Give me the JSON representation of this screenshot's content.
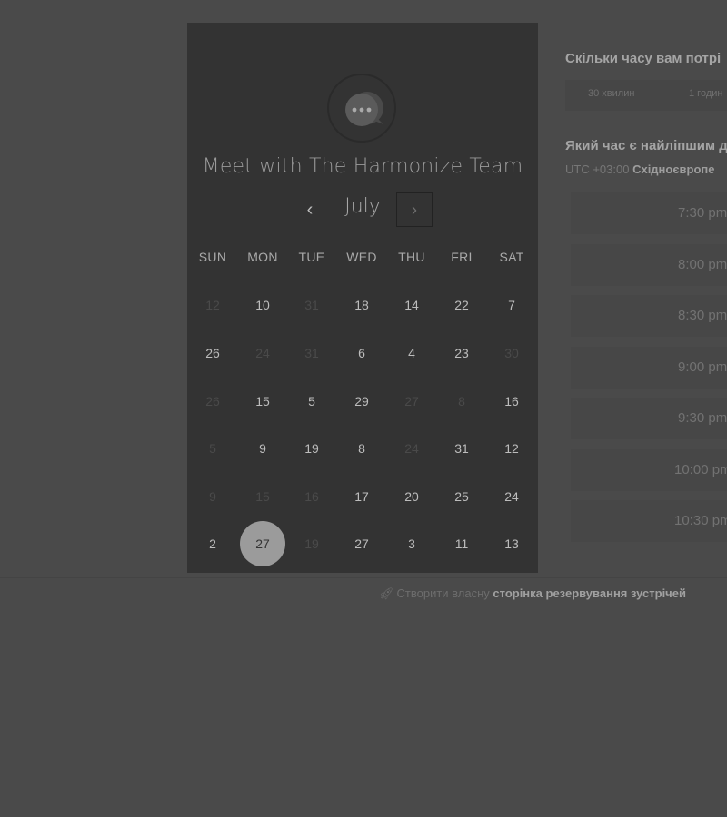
{
  "calendar": {
    "title": "Meet with The Harmonize Team",
    "month": "July",
    "prev_icon": "‹",
    "next_icon": "›",
    "weekdays": [
      "SUN",
      "MON",
      "TUE",
      "WED",
      "THU",
      "FRI",
      "SAT"
    ],
    "weeks": [
      [
        {
          "d": "12",
          "m": true
        },
        {
          "d": "10",
          "m": false
        },
        {
          "d": "31",
          "m": true
        },
        {
          "d": "18",
          "m": false
        },
        {
          "d": "14",
          "m": false
        },
        {
          "d": "22",
          "m": false
        },
        {
          "d": "7",
          "m": false
        }
      ],
      [
        {
          "d": "26",
          "m": false
        },
        {
          "d": "24",
          "m": true
        },
        {
          "d": "31",
          "m": true
        },
        {
          "d": "6",
          "m": false
        },
        {
          "d": "4",
          "m": false
        },
        {
          "d": "23",
          "m": false
        },
        {
          "d": "30",
          "m": true
        }
      ],
      [
        {
          "d": "26",
          "m": true
        },
        {
          "d": "15",
          "m": false
        },
        {
          "d": "5",
          "m": false
        },
        {
          "d": "29",
          "m": false
        },
        {
          "d": "27",
          "m": true
        },
        {
          "d": "8",
          "m": true
        },
        {
          "d": "16",
          "m": false
        }
      ],
      [
        {
          "d": "5",
          "m": true
        },
        {
          "d": "9",
          "m": false
        },
        {
          "d": "19",
          "m": false
        },
        {
          "d": "8",
          "m": false
        },
        {
          "d": "24",
          "m": true
        },
        {
          "d": "31",
          "m": false
        },
        {
          "d": "12",
          "m": false
        }
      ],
      [
        {
          "d": "9",
          "m": true
        },
        {
          "d": "15",
          "m": true
        },
        {
          "d": "16",
          "m": true
        },
        {
          "d": "17",
          "m": false
        },
        {
          "d": "20",
          "m": false
        },
        {
          "d": "25",
          "m": false
        },
        {
          "d": "24",
          "m": false
        }
      ],
      [
        {
          "d": "2",
          "m": false
        },
        {
          "d": "27",
          "m": false,
          "sel": true
        },
        {
          "d": "19",
          "m": true
        },
        {
          "d": "27",
          "m": false
        },
        {
          "d": "3",
          "m": false
        },
        {
          "d": "11",
          "m": false
        },
        {
          "d": "13",
          "m": false
        }
      ]
    ]
  },
  "booking": {
    "duration_question": "Скільки часу вам потрі",
    "durations": [
      "30 хвилин",
      "1 годин"
    ],
    "time_question": "Який час є найліпшим д",
    "timezone_prefix": "UTC +03:00 ",
    "timezone_name": "Східноєвропе",
    "slots": [
      "7:30 pm",
      "8:00 pm",
      "8:30 pm",
      "9:00 pm",
      "9:30 pm",
      "10:00 pm",
      "10:30 pm"
    ]
  },
  "footer": {
    "icon": "rocket-icon",
    "prefix": "Створити власну ",
    "link": "сторінка резервування зустрічей"
  }
}
